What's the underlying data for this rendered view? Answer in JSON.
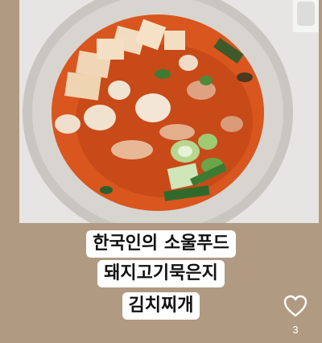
{
  "post": {
    "image_icon": "food-photo-kimchi-jjigae",
    "caption_lines": [
      "한국인의 소울푸드",
      "돼지고기묵은지",
      "김치찌개"
    ]
  },
  "actions": {
    "like_icon": "heart-outline-icon",
    "like_count": "3"
  },
  "colors": {
    "background": "#b09a82",
    "caption_bg": "#ffffff",
    "stew": "#d9561f"
  }
}
